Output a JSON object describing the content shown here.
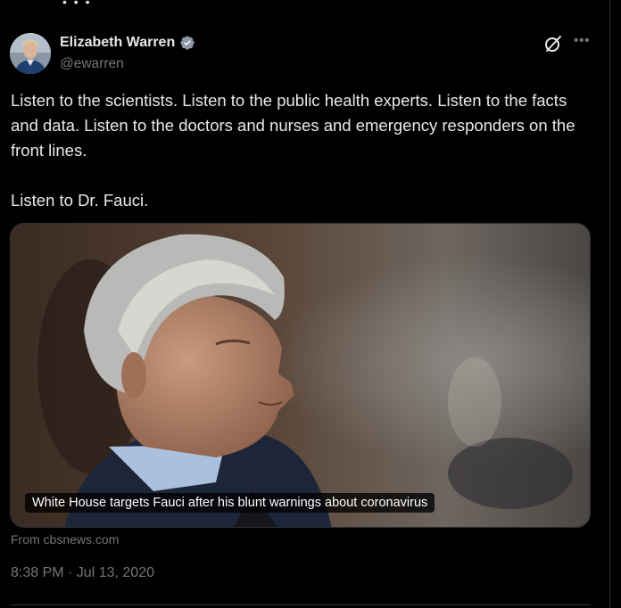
{
  "author": {
    "display_name": "Elizabeth Warren",
    "handle": "@ewarren",
    "verified": true
  },
  "tweet": {
    "text": "Listen to the scientists. Listen to the public health experts. Listen to the facts and data. Listen to the doctors and nurses and emergency responders on the front lines.\n\nListen to Dr. Fauci.",
    "timestamp": "8:38 PM · Jul 13, 2020"
  },
  "link_card": {
    "caption": "White House targets Fauci after his blunt warnings about coronavirus",
    "source": "From cbsnews.com"
  },
  "colors": {
    "background": "#000000",
    "text_primary": "#e7e9ea",
    "text_secondary": "#71767b",
    "verified_badge": "#8b98a5",
    "border": "#2f3336"
  },
  "icons": {
    "verified": "verified-badge-icon",
    "grok": "grok-icon",
    "more": "more-options-icon"
  }
}
